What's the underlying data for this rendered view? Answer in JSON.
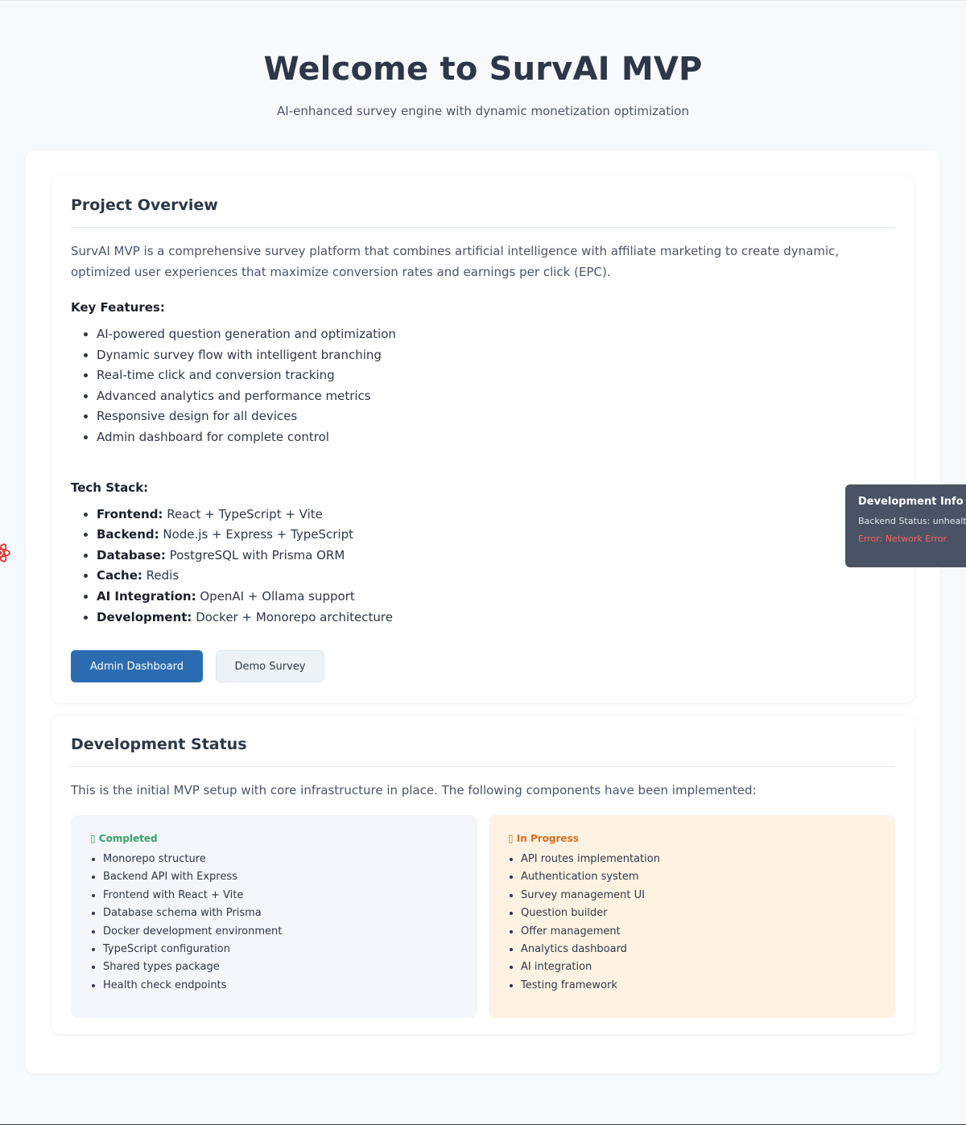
{
  "hero": {
    "title": "Welcome to SurvAI MVP",
    "subtitle": "AI-enhanced survey engine with dynamic monetization optimization"
  },
  "overview": {
    "heading": "Project Overview",
    "intro": "SurvAI MVP is a comprehensive survey platform that combines artificial intelligence with affiliate marketing to create dynamic, optimized user experiences that maximize conversion rates and earnings per click (EPC).",
    "features_heading": "Key Features:",
    "features": [
      "AI-powered question generation and optimization",
      "Dynamic survey flow with intelligent branching",
      "Real-time click and conversion tracking",
      "Advanced analytics and performance metrics",
      "Responsive design for all devices",
      "Admin dashboard for complete control"
    ],
    "tech_heading": "Tech Stack:",
    "tech": [
      {
        "label": "Frontend:",
        "value": "React + TypeScript + Vite"
      },
      {
        "label": "Backend:",
        "value": "Node.js + Express + TypeScript"
      },
      {
        "label": "Database:",
        "value": "PostgreSQL with Prisma ORM"
      },
      {
        "label": "Cache:",
        "value": "Redis"
      },
      {
        "label": "AI Integration:",
        "value": "OpenAI + Ollama support"
      },
      {
        "label": "Development:",
        "value": "Docker + Monorepo architecture"
      }
    ],
    "buttons": {
      "admin": "Admin Dashboard",
      "demo": "Demo Survey"
    }
  },
  "status": {
    "heading": "Development Status",
    "intro": "This is the initial MVP setup with core infrastructure in place. The following components have been implemented:",
    "completed": {
      "title": "▯ Completed",
      "items": [
        "Monorepo structure",
        "Backend API with Express",
        "Frontend with React + Vite",
        "Database schema with Prisma",
        "Docker development environment",
        "TypeScript configuration",
        "Shared types package",
        "Health check endpoints"
      ]
    },
    "in_progress": {
      "title": "▯ In Progress",
      "items": [
        "API routes implementation",
        "Authentication system",
        "Survey management UI",
        "Question builder",
        "Offer management",
        "Analytics dashboard",
        "AI integration",
        "Testing framework"
      ]
    }
  },
  "dev_info": {
    "title": "Development Info",
    "backend_status": "Backend Status: unhealthy",
    "error": "Error: Network Error"
  },
  "icons": {
    "react_logo": "react-atom-icon"
  },
  "colors": {
    "primary": "#2b6cb0",
    "completed": "#38a169",
    "in_progress": "#dd6b20",
    "error": "#f56565"
  }
}
